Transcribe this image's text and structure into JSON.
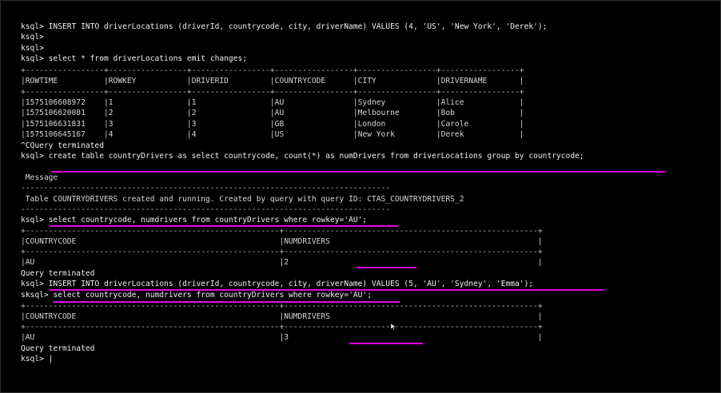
{
  "terminal": {
    "lines": [
      "ksql> INSERT INTO driverLocations (driverId, countrycode, city, driverName) VALUES (4, 'US', 'New York', 'Derek');",
      "ksql>",
      "ksql>",
      "ksql> select * from driverLocations emit changes;",
      "+-----------------+-----------------+-----------------+-----------------+-----------------+-----------------+",
      "|ROWTIME          |ROWKEY           |DRIVERID         |COUNTRYCODE      |CITY             |DRIVERNAME       |",
      "+-----------------+-----------------+-----------------+-----------------+-----------------+-----------------+",
      "|1575106608972    |1                |1                |AU               |Sydney           |Alice            |",
      "|1575106620081    |2                |2                |AU               |Melbourne        |Bob              |",
      "|1575106631831    |3                |3                |GB               |London           |Carole           |",
      "|1575106645167    |4                |4                |US               |New York         |Derek            |",
      "^CQuery terminated",
      "ksql> create table countryDrivers as select countrycode, count(*) as numDrivers from driverLocations group by countrycode;",
      "",
      " Message",
      "--------------------------------------------------------------------------------",
      " Table COUNTRYDRIVERS created and running. Created by query with query ID: CTAS_COUNTRYDRIVERS_2",
      "--------------------------------------------------------------------------------",
      "ksql> select countrycode, numdrivers from countryDrivers where rowkey='AU';",
      "+-------------------------------------------------------+-------------------------------------------------------+",
      "|COUNTRYCODE                                            |NUMDRIVERS                                             |",
      "+-------------------------------------------------------+-------------------------------------------------------+",
      "|AU                                                     |2                                                      |",
      "Query terminated",
      "ksql> INSERT INTO driverLocations (driverId, countrycode, city, driverName) VALUES (5, 'AU', 'Sydney', 'Emma');",
      "sksql> select countrycode, numdrivers from countryDrivers where rowkey='AU';",
      "+-------------------------------------------------------+-------------------------------------------------------+",
      "|COUNTRYCODE                                            |NUMDRIVERS                                             |",
      "+-------------------------------------------------------+-------------------------------------------------------+",
      "|AU                                                     |3                                                      |",
      "Query terminated",
      "ksql> |"
    ],
    "colors": {
      "background": "#000000",
      "text": "#d6d6d6",
      "annotation": "#e000e0"
    }
  }
}
